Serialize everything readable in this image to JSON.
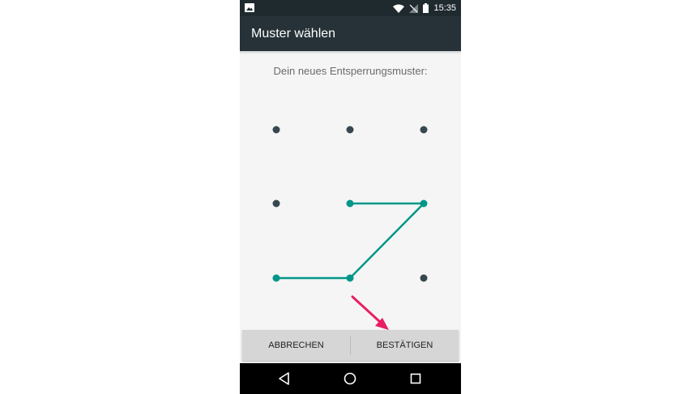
{
  "status_bar": {
    "time": "15:35"
  },
  "app_bar": {
    "title": "Muster wählen"
  },
  "instruction": "Dein neues Entsperrungsmuster:",
  "pattern": {
    "grid": 3,
    "selected_path": [
      [
        1,
        1
      ],
      [
        1,
        2
      ],
      [
        2,
        1
      ],
      [
        2,
        0
      ]
    ],
    "dot_color": "#37474f",
    "path_color": "#009688"
  },
  "buttons": {
    "cancel": "ABBRECHEN",
    "confirm": "BESTÄTIGEN"
  },
  "annotation": {
    "arrow_color": "#e91e63"
  },
  "colors": {
    "status_bar": "#1f2a2e",
    "app_bar": "#263237",
    "background": "#f5f5f5"
  }
}
